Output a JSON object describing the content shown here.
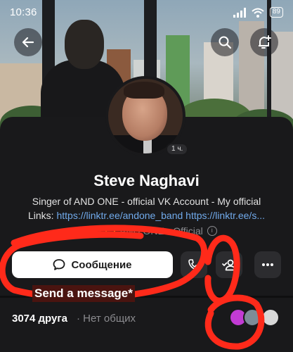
{
  "status_bar": {
    "time": "10:36",
    "battery": "89"
  },
  "header": {
    "back_icon": "arrow-left-icon",
    "search_icon": "search-icon",
    "notify_icon": "bell-plus-icon"
  },
  "profile": {
    "online": "1 ч.",
    "name": "Steve Naghavi",
    "bio_line1": "Singer of AND ONE - official VK Account -  My official",
    "bio_links_label": "Links: ",
    "bio_links": "https://linktr.ee/andone_band https://linktr.ee/s...",
    "city": "Berlin",
    "community": "AND ONE - Official",
    "info_icon": "info-icon"
  },
  "actions": {
    "message_label": "Сообщение",
    "call_icon": "phone-icon",
    "friend_icon": "user-check-icon",
    "more_icon": "more-horizontal-icon"
  },
  "friends": {
    "count": "3074 друга",
    "separator": "·",
    "common": "Нет общих"
  },
  "annotation": {
    "label": "Send a message*",
    "color": "#ff2a1a"
  }
}
